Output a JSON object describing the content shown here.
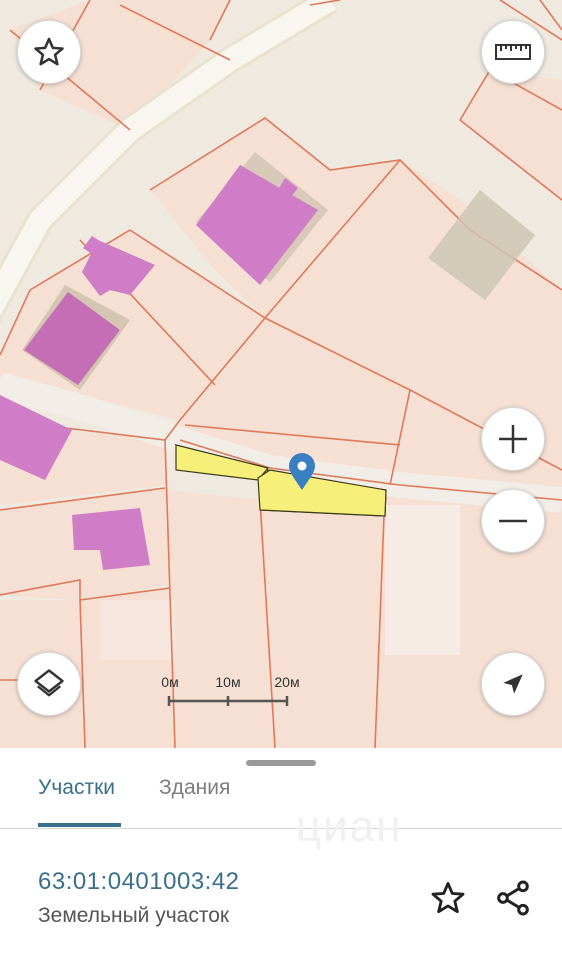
{
  "map": {
    "icons": {
      "favorite": "star-outline-icon",
      "ruler": "ruler-icon",
      "zoom_in": "plus-icon",
      "zoom_out": "minus-icon",
      "layers": "layers-icon",
      "location": "navigation-arrow-icon",
      "marker": "map-pin-icon"
    },
    "scale": {
      "labels": [
        "0м",
        "10м",
        "20м"
      ]
    },
    "colors": {
      "background": "#efe9df",
      "parcel_fill": "#f5dfd2",
      "parcel_border": "#e0785a",
      "building": "#cf7dc6",
      "selected_parcel": "#f6f07a",
      "marker": "#3a7fc1"
    }
  },
  "sheet": {
    "tabs": [
      {
        "label": "Участки",
        "active": true
      },
      {
        "label": "Здания",
        "active": false
      }
    ],
    "watermark": "циан",
    "parcel": {
      "cadastral_number": "63:01:0401003:42",
      "type": "Земельный участок"
    },
    "actions": {
      "favorite": "star-outline-icon",
      "share": "share-icon"
    },
    "accent": "#3a6f8c"
  }
}
